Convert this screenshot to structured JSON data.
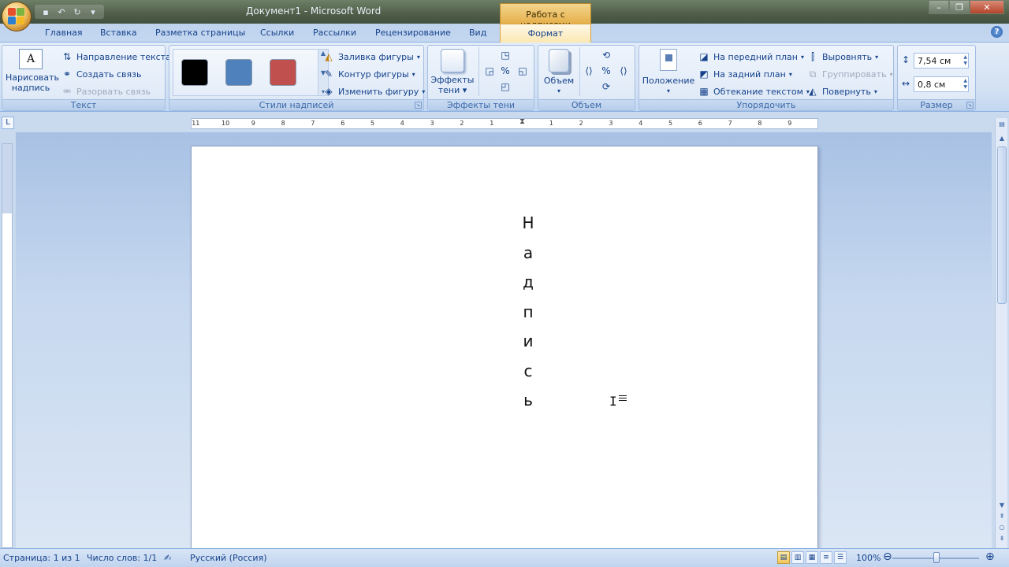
{
  "window": {
    "title": "Документ1 - Microsoft Word",
    "contextual_tab_group": "Работа с надписями"
  },
  "tabs": [
    {
      "label": "Главная"
    },
    {
      "label": "Вставка"
    },
    {
      "label": "Разметка страницы"
    },
    {
      "label": "Ссылки"
    },
    {
      "label": "Рассылки"
    },
    {
      "label": "Рецензирование"
    },
    {
      "label": "Вид"
    },
    {
      "label": "Формат",
      "active": true
    }
  ],
  "ribbon": {
    "text_group": {
      "label": "Текст",
      "draw_textbox": "Нарисовать надпись",
      "draw_textbox_line1": "Нарисовать",
      "draw_textbox_line2": "надпись",
      "text_direction": "Направление текста",
      "create_link": "Создать связь",
      "break_link": "Разорвать связь"
    },
    "styles_group": {
      "label": "Стили надписей",
      "swatches": [
        "#000000",
        "#4f81bd",
        "#c0504d"
      ],
      "shape_fill": "Заливка фигуры",
      "shape_outline": "Контур фигуры",
      "change_shape": "Изменить фигуру"
    },
    "shadow_group": {
      "label": "Эффекты тени",
      "shadow_effects_line1": "Эффекты",
      "shadow_effects_line2": "тени"
    },
    "volume_group": {
      "label": "Объем",
      "volume": "Объем"
    },
    "arrange_group": {
      "label": "Упорядочить",
      "position": "Положение",
      "bring_front": "На передний план",
      "send_back": "На задний план",
      "text_wrap": "Обтекание текстом",
      "align": "Выровнять",
      "group": "Группировать",
      "rotate": "Повернуть"
    },
    "size_group": {
      "label": "Размер",
      "height": "7,54 см",
      "width": "0,8 см"
    }
  },
  "ruler": {
    "left_numbers": [
      "11",
      "10",
      "9",
      "8",
      "7",
      "6",
      "5",
      "4",
      "3",
      "2",
      "1"
    ],
    "right_numbers": [
      "1",
      "2",
      "3",
      "4",
      "5",
      "6",
      "7",
      "8",
      "9"
    ]
  },
  "document": {
    "textbox_text": "Надпись",
    "letters": [
      "Н",
      "а",
      "д",
      "п",
      "и",
      "с",
      "ь"
    ]
  },
  "statusbar": {
    "page": "Страница: 1 из 1",
    "words": "Число слов: 1/1",
    "language": "Русский (Россия)",
    "zoom": "100%"
  }
}
